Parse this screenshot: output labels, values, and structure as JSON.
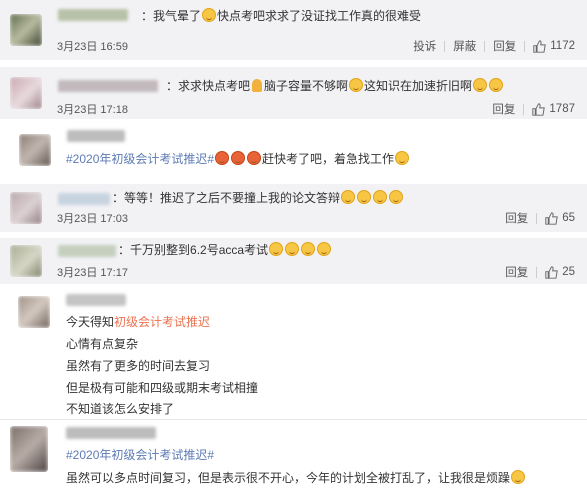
{
  "comments": [
    {
      "text": "我气晕了",
      "emoji_1": "crying-laughing",
      "text_2": "快点考吧求求了没证找工作真的很难受",
      "time": "3月23日 16:59",
      "report": "投诉",
      "block": "屏蔽",
      "reply": "回复",
      "likes": "1172"
    },
    {
      "text": "求求快点考吧",
      "emoji_1": "praying-hands",
      "text_2": "脑子容量不够啊",
      "emoji_2": "crying-laughing",
      "text_3": "这知识在加速折旧啊",
      "time": "3月23日 17:18",
      "reply": "回复",
      "likes": "1787"
    },
    {
      "topic": "#2020年初级会计考试推迟#",
      "text": "赶快考了吧，着急找工作"
    },
    {
      "text": "等等！推迟了之后不要撞上我的论文答辩",
      "time": "3月23日 17:03",
      "reply": "回复",
      "likes": "65"
    },
    {
      "text": "千万别整到6.2号acca考试",
      "time": "3月23日 17:17",
      "reply": "回复",
      "likes": "25"
    },
    {
      "line_1_prefix": "今天得知",
      "line_1_tag": "初级会计考试推迟",
      "line_2": "心情有点复杂",
      "line_3": "虽然有了更多的时间去复习",
      "line_4": "但是极有可能和四级或期末考试相撞",
      "line_5": "不知道该怎么安排了"
    },
    {
      "topic": "#2020年初级会计考试推迟#",
      "text": "虽然可以多点时间复习，但是表示很不开心，今年的计划全被打乱了，让我很是烦躁"
    }
  ],
  "colors": {
    "card_shade": "#f2f2f5",
    "topic_blue": "#5d7bb5",
    "tag_orange": "#eb7350"
  },
  "icons": {
    "like": "thumbs-up-icon",
    "emoji": "crying-laughing-emoji",
    "pray": "praying-hands-emoji"
  }
}
